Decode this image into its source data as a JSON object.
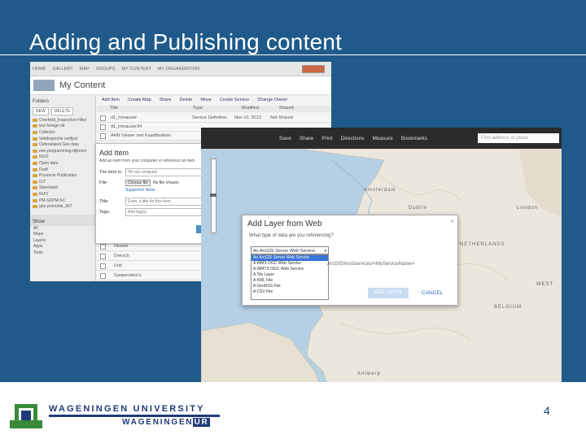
{
  "slide": {
    "title": "Adding and Publishing content",
    "page_number": "4"
  },
  "my_content": {
    "nav": [
      "HOME",
      "GALLERY",
      "MAP",
      "GROUPS",
      "MY CONTENT",
      "MY ORGANIZATION"
    ],
    "header_title": "My Content",
    "folders_heading": "Folders",
    "folder_buttons": [
      "NEW",
      "DELETE"
    ],
    "folders": [
      "Overfield_Inspection-Hiller",
      "test foreign dir",
      "Collector",
      "Veldinspectie verfijnd",
      "Oefeneiland Geo data",
      "eeo-programming-dijkmen",
      "NGO",
      "Open data",
      "Draft",
      "Provincie Publicaties",
      "ICT",
      "Standaard",
      "NUO",
      "PM-SDPM-SC",
      "geo-promotie_367"
    ],
    "show_heading": "Show",
    "show_items": [
      "All",
      "Maps",
      "Layers",
      "Apps",
      "Tools"
    ],
    "toolbar": [
      "Add Item",
      "Create Map",
      "Share",
      "Delete",
      "Move",
      "Create Service",
      "Change Owner"
    ],
    "columns": [
      "Title",
      "Type",
      "Modified",
      "Shared"
    ],
    "rows": [
      {
        "title": "d1_mmauser",
        "type": "Service Definition",
        "modified": "Nov 10, 2013",
        "shared": "Not Shared"
      },
      {
        "title": "d1_mmauser34",
        "type": "",
        "modified": "",
        "shared": ""
      },
      {
        "title": "AHN Viewer met Kaartblokken",
        "type": "",
        "modified": "",
        "shared": ""
      }
    ],
    "lower_rows": [
      "Hirsem",
      "Deirsch",
      "Unit",
      "Gasperstein's"
    ]
  },
  "add_item": {
    "title": "Add Item",
    "subtitle": "Add an item from your computer or reference an item",
    "item_is_label": "The item is:",
    "item_is_value": "On my computer",
    "file_label": "File:",
    "choose_label": "Choose file",
    "no_file_label": "No file chosen",
    "supported_link": "Supported items",
    "title_label": "Title:",
    "title_placeholder": "Enter a title for this item",
    "tags_label": "Tags:",
    "tags_placeholder": "Add tag(s)"
  },
  "map_viewer": {
    "toolbar": [
      "Save",
      "Share",
      "Print",
      "Directions",
      "Measure",
      "Bookmarks"
    ],
    "find_placeholder": "Find address or place",
    "place_labels": [
      "Amsterdam",
      "Antwerp",
      "London",
      "Dublin",
      "NETHERLANDS",
      "BELGIUM",
      "WEST"
    ]
  },
  "add_layer": {
    "title": "Add Layer from Web",
    "close_label": "×",
    "question": "What type of data are you referencing?",
    "selected_option": "An ArcGIS Server Web Service",
    "options": [
      "An ArcGIS Server Web Service",
      "A WMS OGC Web Service",
      "A WMTS OGC Web Service",
      "A Tile Layer",
      "A KML File",
      "A GeoRSS File",
      "A CSV File"
    ],
    "url_hint": "ArcGIS/rest/services/<MyServiceName>",
    "add_button": "ADD LAYER",
    "cancel_button": "CANCEL"
  },
  "footer": {
    "line1": "WAGENINGEN UNIVERSITY",
    "line2_main": "WAGENINGEN",
    "line2_ur": "UR"
  },
  "colors": {
    "slide_bg": "#1f5a8a",
    "brand_blue": "#1f3b78",
    "logo_green": "#3a8a3a"
  }
}
